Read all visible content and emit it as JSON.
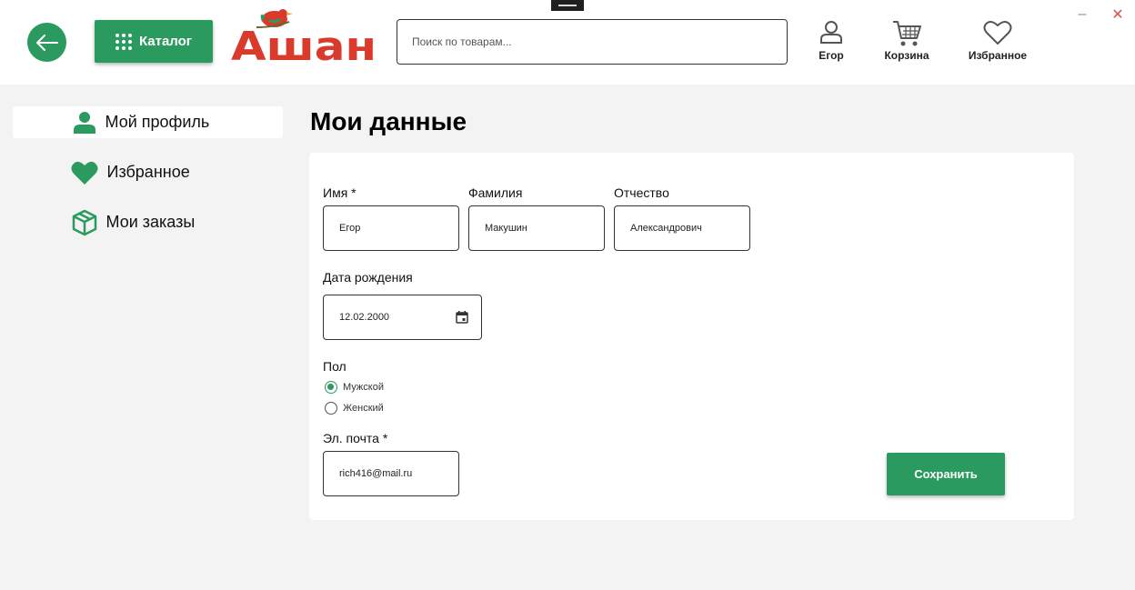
{
  "header": {
    "catalog_label": "Каталог",
    "logo_text": "Ашан",
    "search_placeholder": "Поиск по товарам...",
    "profile_label": "Егор",
    "cart_label": "Корзина",
    "favorites_label": "Избранное",
    "minimize_glyph": "–",
    "close_glyph": "✕"
  },
  "sidebar": {
    "items": [
      {
        "label": "Мой профиль",
        "icon": "user-icon",
        "active": true
      },
      {
        "label": "Избранное",
        "icon": "heart-icon",
        "active": false
      },
      {
        "label": "Мои заказы",
        "icon": "box-icon",
        "active": false
      }
    ]
  },
  "main": {
    "title": "Мои данные",
    "form": {
      "first_name_label": "Имя *",
      "first_name_value": "Егор",
      "last_name_label": "Фамилия",
      "last_name_value": "Макушин",
      "patronymic_label": "Отчество",
      "patronymic_value": "Александрович",
      "birthdate_label": "Дата рождения",
      "birthdate_value": "12.02.2000",
      "gender_label": "Пол",
      "gender_options": [
        {
          "label": "Мужской",
          "selected": true
        },
        {
          "label": "Женский",
          "selected": false
        }
      ],
      "email_label": "Эл. почта *",
      "email_value": "rich416@mail.ru",
      "save_label": "Сохранить"
    }
  },
  "colors": {
    "accent": "#2b9a5f",
    "logo_red": "#d93a2b",
    "background": "#f3f3f3"
  }
}
